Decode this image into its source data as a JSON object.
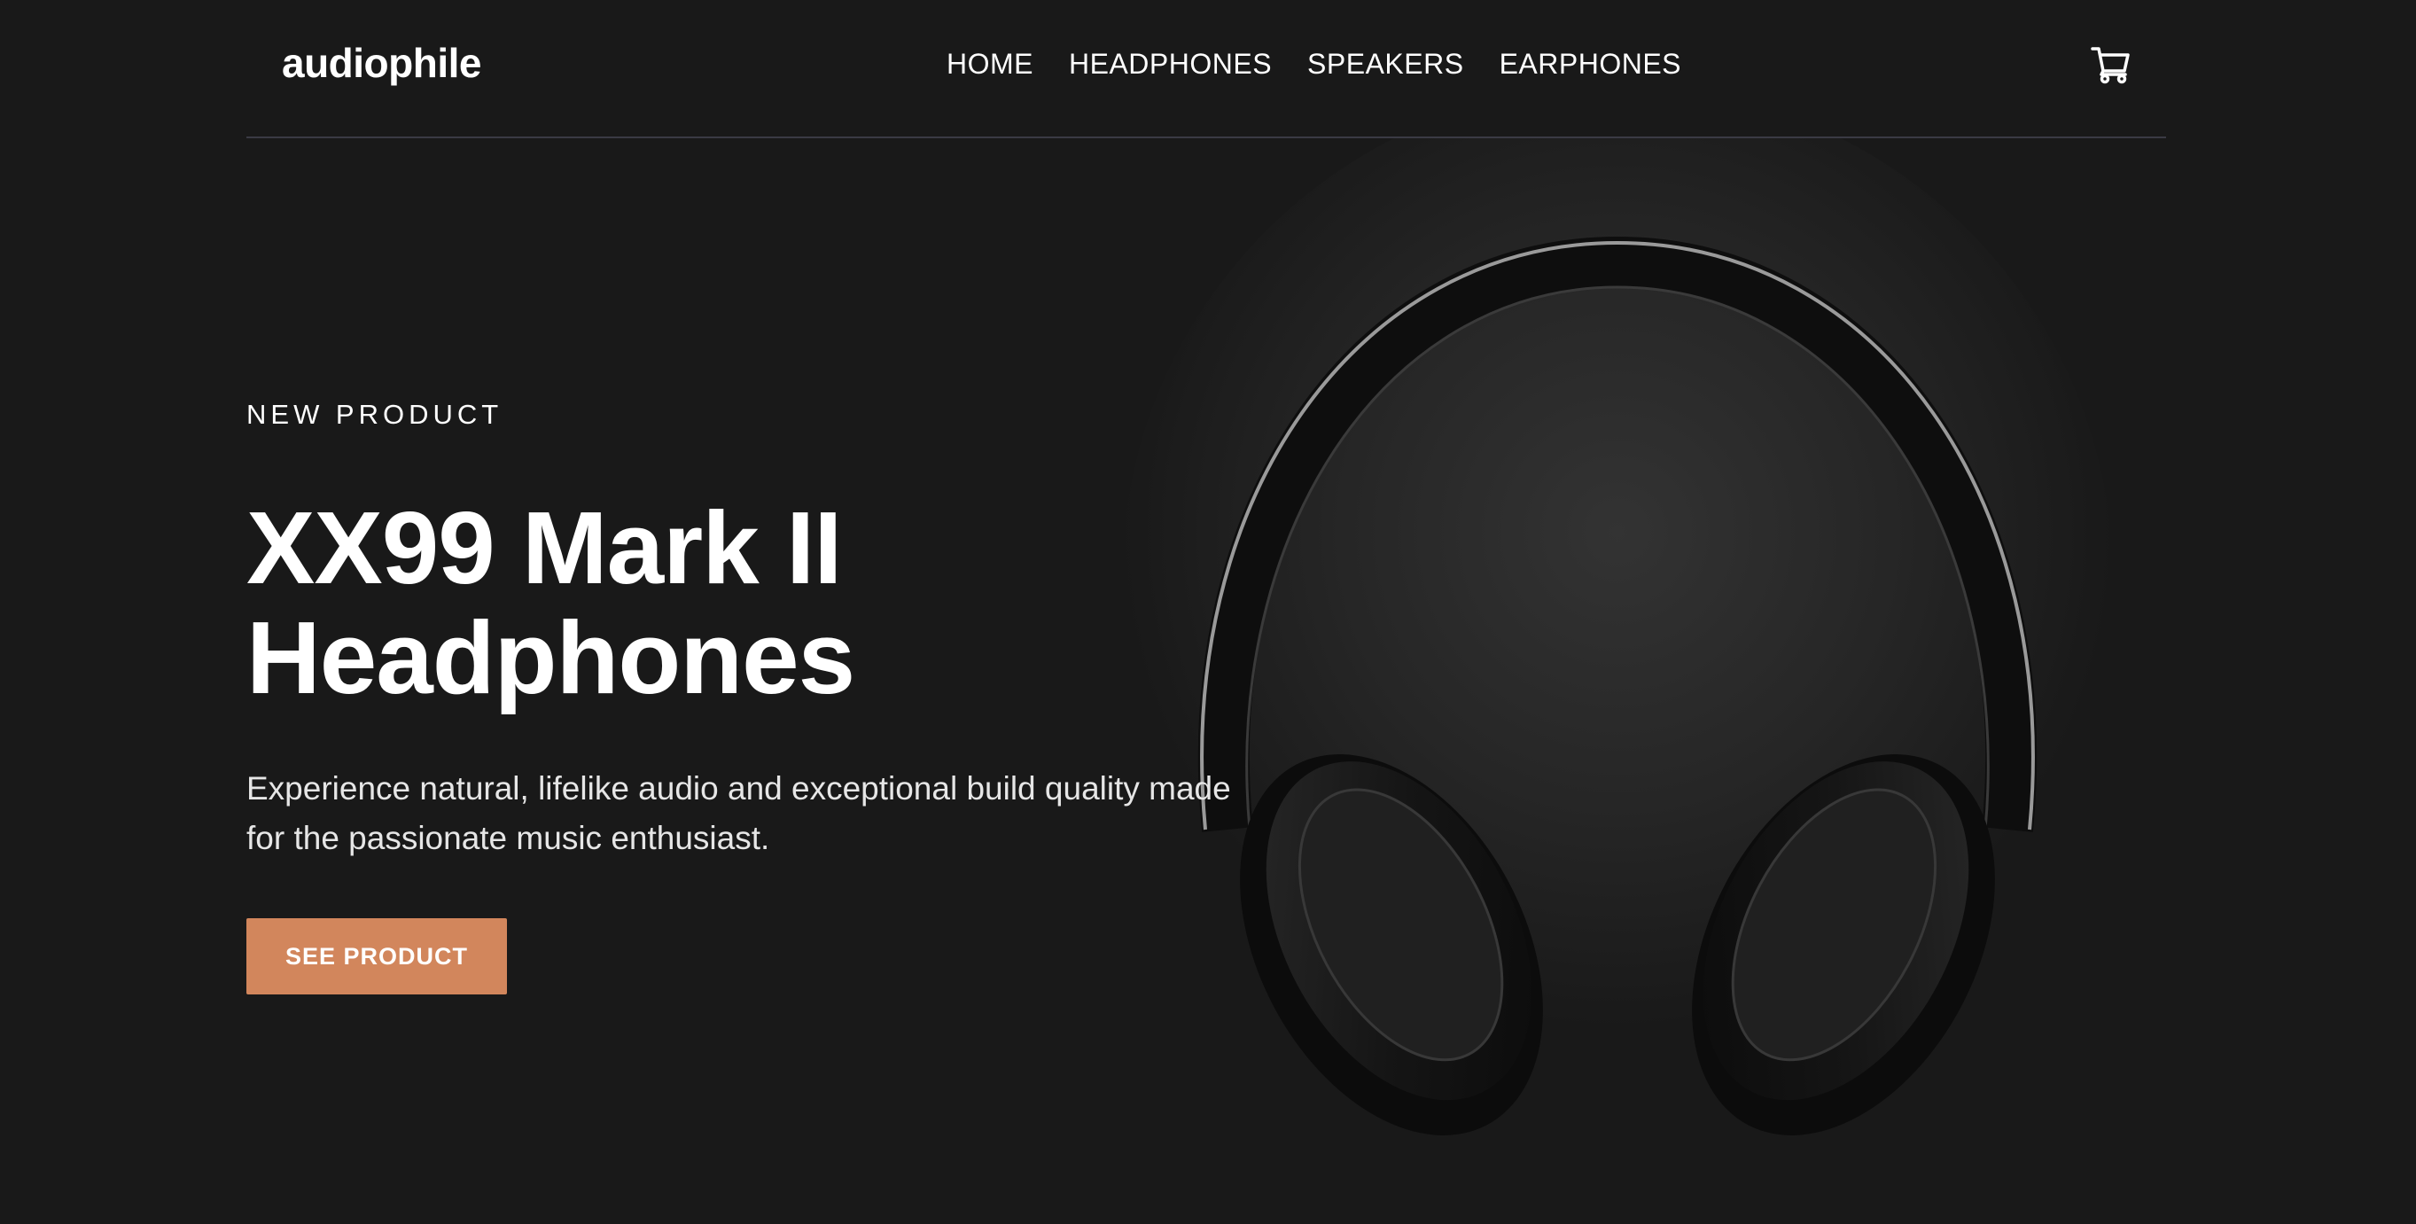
{
  "header": {
    "logo": "audiophile",
    "nav": [
      "HOME",
      "HEADPHONES",
      "SPEAKERS",
      "EARPHONES"
    ],
    "cart_icon": "cart-icon"
  },
  "hero": {
    "eyebrow": "NEW PRODUCT",
    "title": "XX99 Mark II Headphones",
    "description": "Experience natural, lifelike audio and exceptional build quality made for the passionate music enthusiast.",
    "cta_label": "SEE PRODUCT",
    "image_icon": "headphones-image"
  },
  "colors": {
    "background": "#191919",
    "accent": "#d2865c",
    "divider": "#3a3a44",
    "text": "#ffffff"
  }
}
